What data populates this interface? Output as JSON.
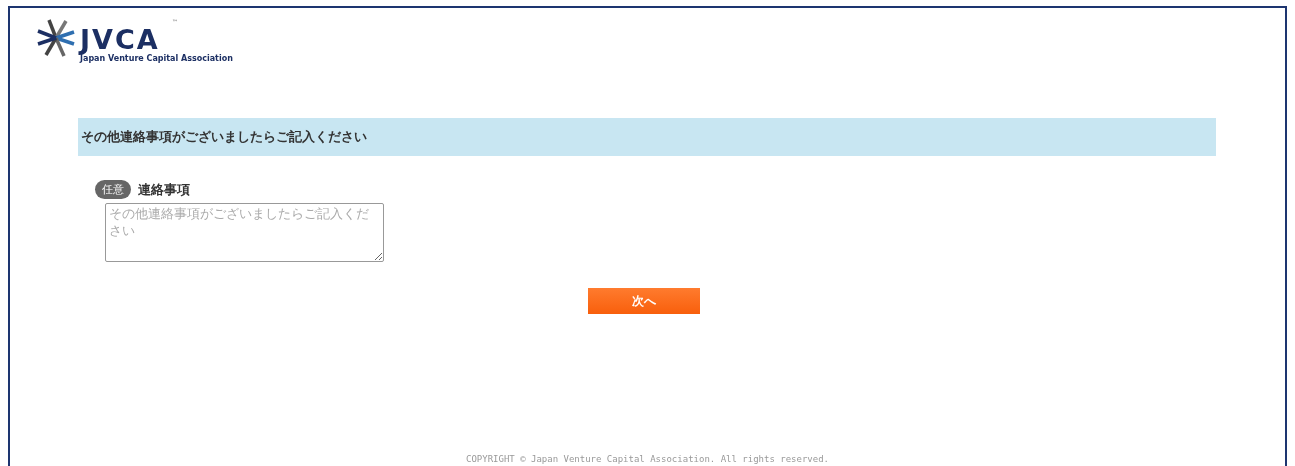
{
  "logo": {
    "wordmark": "JVCA",
    "trademark": "™",
    "tagline": "Japan Venture Capital Association"
  },
  "section": {
    "heading": "その他連絡事項がございましたらご記入ください"
  },
  "fields": [
    {
      "badge": "任意",
      "label": "連絡事項",
      "placeholder": "その他連絡事項がございましたらご記入ください",
      "required": false
    }
  ],
  "buttons": [
    {
      "label": "次へ"
    }
  ],
  "footer": {
    "copyright": "COPYRIGHT © Japan Venture Capital Association. All rights reserved."
  }
}
